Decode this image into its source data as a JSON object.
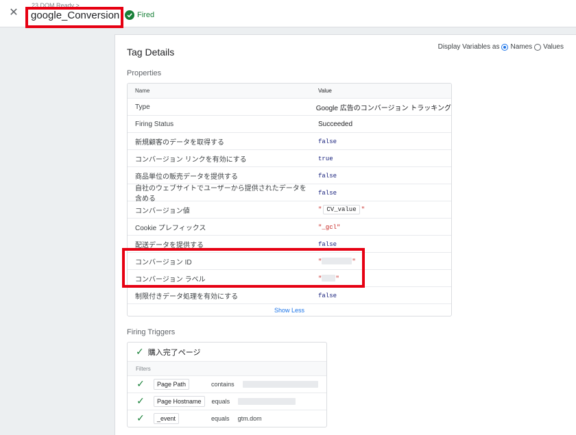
{
  "header": {
    "breadcrumb": "23 DOM Ready >",
    "tag_name": "google_Conversion",
    "status": "Fired"
  },
  "card": {
    "title": "Tag Details",
    "display_variables_label": "Display Variables as",
    "display_options": [
      "Names",
      "Values"
    ],
    "display_selected": "Names",
    "properties_label": "Properties",
    "columns": [
      "Name",
      "Value"
    ],
    "rows": [
      {
        "name": "Type",
        "value": "Google 広告のコンバージョン トラッキング"
      },
      {
        "name": "Firing Status",
        "value": "Succeeded"
      },
      {
        "name": "新規顧客のデータを取得する",
        "value": "false"
      },
      {
        "name": "コンバージョン リンクを有効にする",
        "value": "true"
      },
      {
        "name": "商品単位の販売データを提供する",
        "value": "false"
      },
      {
        "name": "自社のウェブサイトでユーザーから提供されたデータを含める",
        "value": "false"
      },
      {
        "name": "コンバージョン値",
        "value": "CV_value"
      },
      {
        "name": "Cookie プレフィックス",
        "value": "\"_gcl\""
      },
      {
        "name": "配送データを提供する",
        "value": "false"
      },
      {
        "name": "コンバージョン ID",
        "value": "\""
      },
      {
        "name": "コンバージョン ラベル",
        "value": "\""
      },
      {
        "name": "制限付きデータ処理を有効にする",
        "value": "false"
      }
    ],
    "show_less": "Show Less",
    "firing_triggers_label": "Firing Triggers",
    "trigger_name": "購入完了ページ",
    "filters_label": "Filters",
    "filters": [
      {
        "variable": "Page Path",
        "operator": "contains",
        "value": ""
      },
      {
        "variable": "Page Hostname",
        "operator": "equals",
        "value": ""
      },
      {
        "variable": "_event",
        "operator": "equals",
        "value": "gtm.dom"
      }
    ]
  },
  "colors": {
    "accent": "#1a73e8",
    "success": "#188038",
    "highlight": "#e60012"
  }
}
